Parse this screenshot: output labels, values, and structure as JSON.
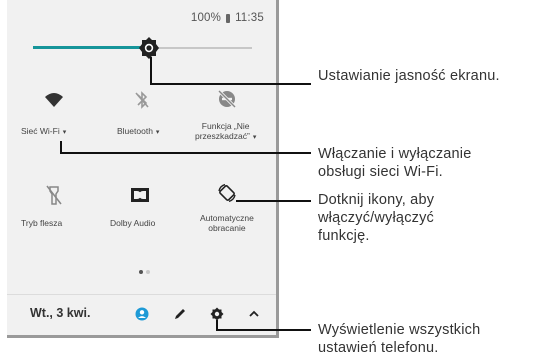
{
  "status_bar": {
    "battery": "100%",
    "time": "11:35"
  },
  "brightness": {
    "level": 0.53,
    "accent": "#16959a"
  },
  "tiles": [
    {
      "icon": "wifi-icon",
      "label": "Sieć Wi-Fi",
      "caret": "▾"
    },
    {
      "icon": "bluetooth-off-icon",
      "label": "Bluetooth",
      "caret": "▾"
    },
    {
      "icon": "do-not-disturb-off-icon",
      "label_line1": "Funkcja „Nie",
      "label_line2": "przeszkadzać”",
      "caret": "▾"
    },
    {
      "icon": "flashlight-off-icon",
      "label": "Tryb flesza"
    },
    {
      "icon": "dolby-icon",
      "label": "Dolby Audio"
    },
    {
      "icon": "auto-rotate-icon",
      "label_line1": "Automatyczne",
      "label_line2": "obracanie"
    }
  ],
  "page_dots": {
    "count": 2,
    "active": 0
  },
  "bottom_bar": {
    "date": "Wt., 3 kwi.",
    "icons": [
      "user-icon",
      "edit-icon",
      "settings-icon",
      "collapse-icon"
    ],
    "user_icon_color": "#1e9ad6"
  },
  "callouts": {
    "brightness": "Ustawianie jasność ekranu.",
    "wifi_line1": "Włączanie i wyłączanie",
    "wifi_line2": "obsługi sieci Wi-Fi.",
    "icons_line1": "Dotknij ikony, aby",
    "icons_line2": "włączyć/wyłączyć",
    "icons_line3": "funkcję.",
    "settings_line1": "Wyświetlenie wszystkich",
    "settings_line2": "ustawień telefonu."
  }
}
